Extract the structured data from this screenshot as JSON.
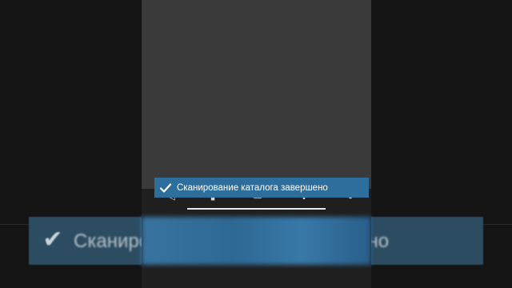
{
  "toast": {
    "message": "Сканирование каталога завершено",
    "icon": "checkmark-icon",
    "background_color": "#2d6e9c"
  },
  "background": {
    "banner_text": "Сканирование каталога завершено",
    "banner_color": "#2f5168"
  },
  "phone": {
    "screen_color": "#3a3a3a",
    "toolbar_icons": [
      "share-icon",
      "bookmark-icon",
      "chat-icon",
      "settings-icon",
      "close-icon"
    ]
  }
}
